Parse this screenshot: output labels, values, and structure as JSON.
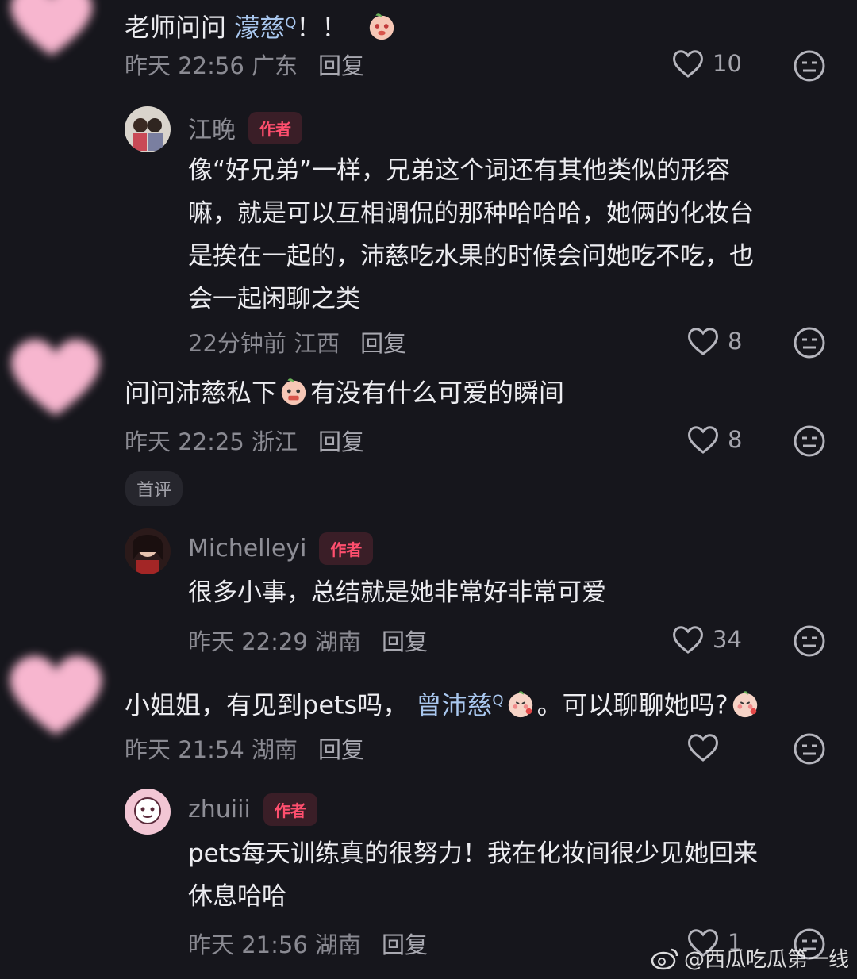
{
  "comments": [
    {
      "text_prefix": "老师问问 ",
      "mention": "濛慈",
      "text_suffix": "！！",
      "date": "昨天 22:56",
      "location": "广东",
      "reply_label": "回复",
      "likes": "10"
    },
    {
      "author": "江晚",
      "author_tag": "作者",
      "lines": [
        "像“好兄弟”一样，兄弟这个词还有其他类似的形容",
        "嘛，就是可以互相调侃的那种哈哈哈，她俩的化妆台",
        "是挨在一起的，沛慈吃水果的时候会问她吃不吃，也",
        "会一起闲聊之类"
      ],
      "date": "22分钟前",
      "location": "江西",
      "reply_label": "回复",
      "likes": "8"
    },
    {
      "text_prefix": "问问沛慈私下",
      "text_suffix": "有没有什么可爱的瞬间",
      "date": "昨天 22:25",
      "location": "浙江",
      "reply_label": "回复",
      "likes": "8",
      "badge": "首评"
    },
    {
      "author": "Michelleyi",
      "author_tag": "作者",
      "lines": [
        "很多小事，总结就是她非常好非常可爱"
      ],
      "date": "昨天 22:29",
      "location": "湖南",
      "reply_label": "回复",
      "likes": "34"
    },
    {
      "text_prefix": "小姐姐，有见到pets吗，",
      "mention": "曾沛慈",
      "text_middle": "。可以聊聊她吗?",
      "date": "昨天 21:54",
      "location": "湖南",
      "reply_label": "回复",
      "likes": ""
    },
    {
      "author": "zhuiii",
      "author_tag": "作者",
      "lines": [
        "pets每天训练真的很努力！我在化妆间很少见她回来",
        "休息哈哈"
      ],
      "date": "昨天 21:56",
      "location": "湖南",
      "reply_label": "回复",
      "likes": "1"
    }
  ],
  "watermark": "@西瓜吃瓜第一线",
  "colors": {
    "background": "#16161c",
    "author_tag": "#ff4f6e",
    "mention": "#a9c7ee",
    "avatar_heart": "#f7b6cf"
  }
}
